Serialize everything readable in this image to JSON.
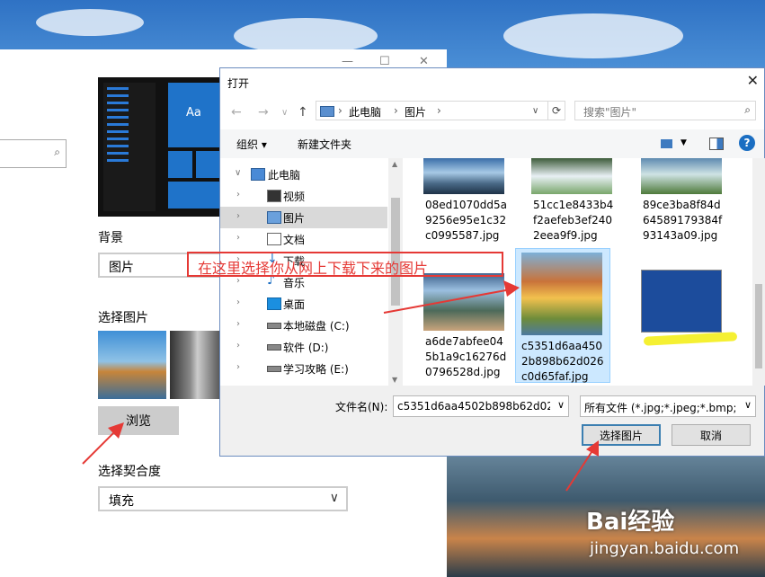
{
  "settings": {
    "background_label": "背景",
    "background_value": "图片",
    "choose_picture_label": "选择图片",
    "browse_label": "浏览",
    "fit_label": "选择契合度",
    "fit_value": "填充",
    "preview_tile_text": "Aa"
  },
  "dialog": {
    "title": "打开",
    "breadcrumb": [
      "此电脑",
      "图片"
    ],
    "search_placeholder": "搜索\"图片\"",
    "toolbar": {
      "organize": "组织",
      "new_folder": "新建文件夹"
    },
    "tree": [
      {
        "name": "此电脑",
        "icon": "computer-icon",
        "expanded": true
      },
      {
        "name": "视频",
        "icon": "video-folder-icon"
      },
      {
        "name": "图片",
        "icon": "pictures-folder-icon",
        "selected": true
      },
      {
        "name": "文档",
        "icon": "documents-folder-icon"
      },
      {
        "name": "下载",
        "icon": "downloads-folder-icon"
      },
      {
        "name": "音乐",
        "icon": "music-folder-icon"
      },
      {
        "name": "桌面",
        "icon": "desktop-folder-icon"
      },
      {
        "name": "本地磁盘 (C:)",
        "icon": "drive-icon"
      },
      {
        "name": "软件 (D:)",
        "icon": "drive-icon"
      },
      {
        "name": "学习攻略 (E:)",
        "icon": "drive-icon"
      }
    ],
    "files": [
      {
        "name": "08ed1070dd5a9256e95e1c32c0995587.jpg"
      },
      {
        "name": "51cc1e8433b4f2aefeb3ef2402eea9f9.jpg"
      },
      {
        "name": "89ce3ba8f84d64589179384f93143a09.jpg"
      },
      {
        "name": "a6de7abfee045b1a9c16276d0796528d.jpg"
      },
      {
        "name": "c5351d6aa4502b898b62d026c0d65faf.jpg",
        "selected": true
      },
      {
        "name": ""
      }
    ],
    "filename_label": "文件名(N):",
    "filename_value": "c5351d6aa4502b898b62d026",
    "filetype_value": "所有文件 (*.jpg;*.jpeg;*.bmp;*.",
    "select_button": "选择图片",
    "cancel_button": "取消"
  },
  "annotation": {
    "text": "在这里选择你从网上下载下来的图片"
  },
  "watermark": {
    "brand": "Bai经验",
    "url": "jingyan.baidu.com"
  },
  "colors": {
    "accent": "#1f73c9",
    "annotation": "#e53935",
    "highlight": "#f5f032"
  }
}
